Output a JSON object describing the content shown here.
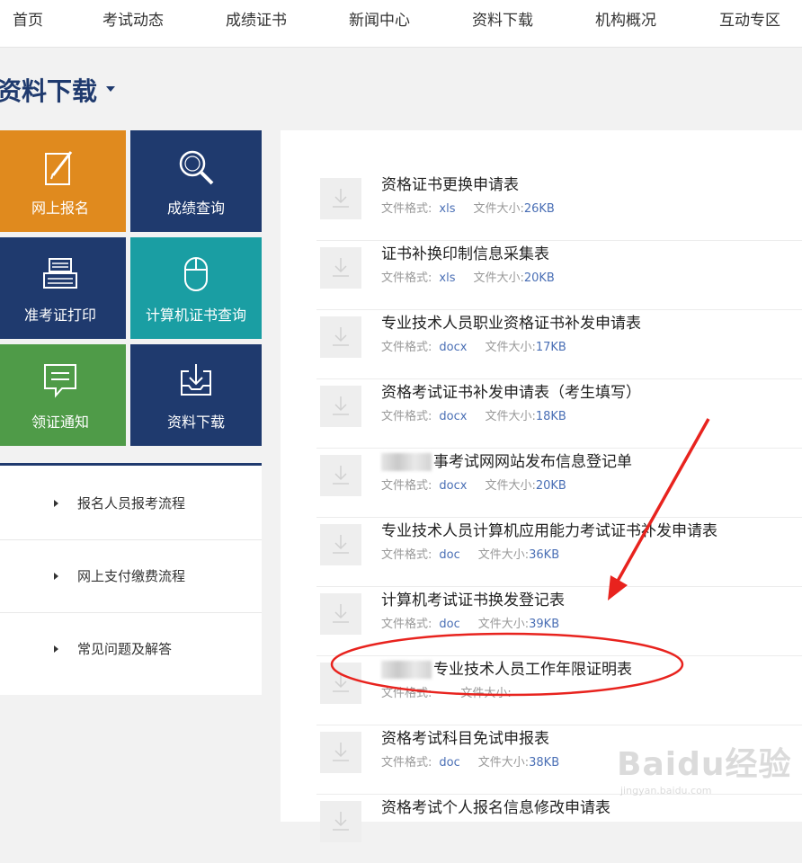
{
  "nav": {
    "items": [
      "首页",
      "考试动态",
      "成绩证书",
      "新闻中心",
      "资料下载",
      "机构概况",
      "互动专区"
    ]
  },
  "section": {
    "title": "资料下载"
  },
  "tiles": [
    {
      "label": "网上报名",
      "icon": "edit-icon",
      "color": "#e08a1e"
    },
    {
      "label": "成绩查询",
      "icon": "search-icon",
      "color": "#1f3a6e"
    },
    {
      "label": "准考证打印",
      "icon": "printer-icon",
      "color": "#1f3a6e"
    },
    {
      "label": "计算机证书查询",
      "icon": "mouse-icon",
      "color": "#1a9ea3"
    },
    {
      "label": "领证通知",
      "icon": "message-icon",
      "color": "#4f9b48"
    },
    {
      "label": "资料下载",
      "icon": "download-tray-icon",
      "color": "#1f3a6e"
    }
  ],
  "links": [
    "报名人员报考流程",
    "网上支付缴费流程",
    "常见问题及解答"
  ],
  "files": {
    "format_label": "文件格式:",
    "size_label": "文件大小:",
    "items": [
      {
        "name": "资格证书更换申请表",
        "format": "xls",
        "size": "26KB"
      },
      {
        "name": "证书补换印制信息采集表",
        "format": "xls",
        "size": "20KB"
      },
      {
        "name": "专业技术人员职业资格证书补发申请表",
        "format": "docx",
        "size": "17KB"
      },
      {
        "name": "资格考试证书补发申请表（考生填写）",
        "format": "docx",
        "size": "18KB"
      },
      {
        "name": "事考试网网站发布信息登记单",
        "format": "docx",
        "size": "20KB"
      },
      {
        "name": "专业技术人员计算机应用能力考试证书补发申请表",
        "format": "doc",
        "size": "36KB"
      },
      {
        "name": "计算机考试证书换发登记表",
        "format": "doc",
        "size": "39KB"
      },
      {
        "name": "专业技术人员工作年限证明表",
        "format": "",
        "size": ""
      },
      {
        "name": "资格考试科目免试申报表",
        "format": "doc",
        "size": "38KB"
      },
      {
        "name": "资格考试个人报名信息修改申请表",
        "format": "",
        "size": ""
      }
    ]
  },
  "watermark": {
    "brand": "Baidu经验",
    "url": "jingyan.baidu.com"
  },
  "annotation": {
    "color": "#e8231e"
  }
}
